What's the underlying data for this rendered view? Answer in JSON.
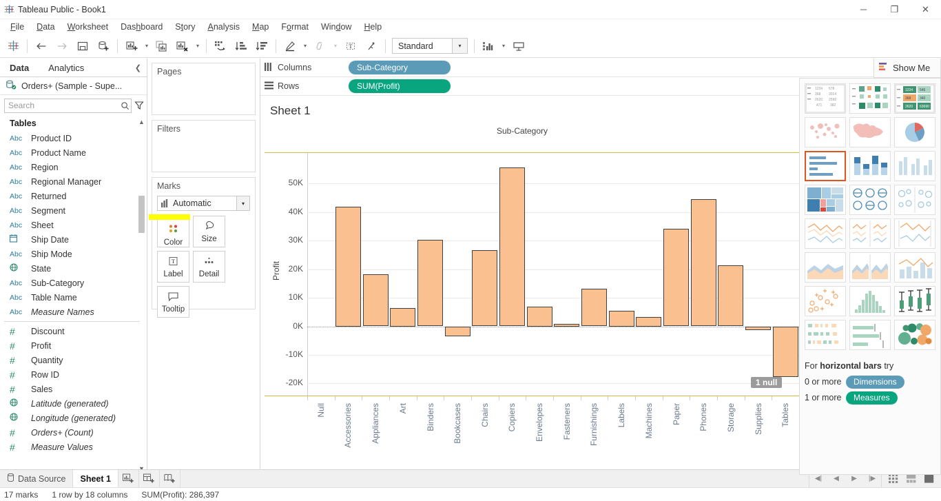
{
  "window": {
    "title": "Tableau Public - Book1",
    "logo_icon": "tableau-logo-icon",
    "minimize": "─",
    "maximize": "❐",
    "close": "✕"
  },
  "menubar": {
    "items": [
      "File",
      "Data",
      "Worksheet",
      "Dashboard",
      "Story",
      "Analysis",
      "Map",
      "Format",
      "Window",
      "Help"
    ]
  },
  "toolbar": {
    "fit_value": "Standard",
    "icons": [
      "tableau-home-icon",
      "undo-icon",
      "redo-icon",
      "save-icon",
      "new-data-source-icon",
      "new-worksheet-icon",
      "duplicate-sheet-icon",
      "clear-sheet-icon",
      "swap-rows-columns-icon",
      "sort-ascending-icon",
      "sort-descending-icon",
      "highlight-icon",
      "group-members-icon",
      "show-mark-labels-icon",
      "presentation-fix-icon",
      "fit-dropdown-icon",
      "show-hide-cards-icon",
      "presentation-mode-icon"
    ]
  },
  "data_pane": {
    "tabs": [
      {
        "label": "Data",
        "active": true
      },
      {
        "label": "Analytics",
        "active": false
      }
    ],
    "collapse_icon": "chevron-left-icon",
    "data_source": "Orders+ (Sample - Supe...",
    "search": {
      "placeholder": "Search",
      "value": ""
    },
    "section_title": "Tables",
    "fields": [
      {
        "icon": "Abc",
        "kind": "text",
        "name": "Product ID",
        "italic": false
      },
      {
        "icon": "Abc",
        "kind": "text",
        "name": "Product Name",
        "italic": false
      },
      {
        "icon": "Abc",
        "kind": "text",
        "name": "Region",
        "italic": false
      },
      {
        "icon": "Abc",
        "kind": "text",
        "name": "Regional Manager",
        "italic": false
      },
      {
        "icon": "Abc",
        "kind": "text",
        "name": "Returned",
        "italic": false
      },
      {
        "icon": "Abc",
        "kind": "text",
        "name": "Segment",
        "italic": false
      },
      {
        "icon": "Abc",
        "kind": "text",
        "name": "Sheet",
        "italic": false
      },
      {
        "icon": "📅",
        "kind": "date",
        "name": "Ship Date",
        "italic": false
      },
      {
        "icon": "Abc",
        "kind": "text",
        "name": "Ship Mode",
        "italic": false
      },
      {
        "icon": "⊕",
        "kind": "geo",
        "name": "State",
        "italic": false
      },
      {
        "icon": "Abc",
        "kind": "text",
        "name": "Sub-Category",
        "italic": false
      },
      {
        "icon": "Abc",
        "kind": "text",
        "name": "Table Name",
        "italic": false
      },
      {
        "icon": "Abc",
        "kind": "text",
        "name": "Measure Names",
        "italic": true
      },
      {
        "icon": "#",
        "kind": "number",
        "name": "Discount",
        "italic": false,
        "divider_before": true
      },
      {
        "icon": "#",
        "kind": "number",
        "name": "Profit",
        "italic": false
      },
      {
        "icon": "#",
        "kind": "number",
        "name": "Quantity",
        "italic": false
      },
      {
        "icon": "#",
        "kind": "number",
        "name": "Row ID",
        "italic": false
      },
      {
        "icon": "#",
        "kind": "number",
        "name": "Sales",
        "italic": false
      },
      {
        "icon": "⊕",
        "kind": "geo",
        "name": "Latitude (generated)",
        "italic": true
      },
      {
        "icon": "⊕",
        "kind": "geo",
        "name": "Longitude (generated)",
        "italic": true
      },
      {
        "icon": "#",
        "kind": "number",
        "name": "Orders+ (Count)",
        "italic": true
      },
      {
        "icon": "#",
        "kind": "number",
        "name": "Measure Values",
        "italic": true
      }
    ]
  },
  "cards": {
    "pages_title": "Pages",
    "filters_title": "Filters",
    "marks_title": "Marks",
    "marks_type": "Automatic",
    "marks_type_icon": "bar-mark-icon",
    "buttons": [
      {
        "label": "Color",
        "icon": "color-palette-icon",
        "highlighted": true
      },
      {
        "label": "Size",
        "icon": "size-icon",
        "highlighted": false
      },
      {
        "label": "Label",
        "icon": "label-text-icon",
        "highlighted": false
      },
      {
        "label": "Detail",
        "icon": "detail-dots-icon",
        "highlighted": false
      },
      {
        "label": "Tooltip",
        "icon": "tooltip-bubble-icon",
        "highlighted": false
      }
    ]
  },
  "shelves": {
    "columns_label": "Columns",
    "columns_icon": "columns-icon",
    "columns_pill": "Sub-Category",
    "rows_label": "Rows",
    "rows_icon": "rows-icon",
    "rows_pill": "SUM(Profit)"
  },
  "sheet": {
    "title": "Sheet 1",
    "null_indicator": "1 null"
  },
  "chart_data": {
    "type": "bar",
    "title": "Sheet 1",
    "xlabel": "Sub-Category",
    "ylabel": "Profit",
    "ylim": [
      -24000,
      60000
    ],
    "yticks": [
      50000,
      40000,
      30000,
      20000,
      10000,
      0,
      -10000,
      -20000
    ],
    "ytick_labels": [
      "50K",
      "40K",
      "30K",
      "20K",
      "10K",
      "0K",
      "-10K",
      "-20K"
    ],
    "grid": true,
    "legend": "none",
    "bar_color": "#fac08f",
    "bar_border_color": "#404040",
    "categories": [
      "Null",
      "Accessories",
      "Appliances",
      "Art",
      "Binders",
      "Bookcases",
      "Chairs",
      "Copiers",
      "Envelopes",
      "Fasteners",
      "Furnishings",
      "Labels",
      "Machines",
      "Paper",
      "Phones",
      "Storage",
      "Supplies",
      "Tables"
    ],
    "values": [
      null,
      41937,
      18138,
      6528,
      30222,
      -3473,
      26590,
      55618,
      6964,
      950,
      13059,
      5546,
      3385,
      34054,
      44516,
      21279,
      -1189,
      -17725
    ]
  },
  "show_me": {
    "tab_label": "Show Me",
    "tab_icon": "show-me-icon",
    "hint_prefix": "For",
    "hint_bold": "horizontal bars",
    "hint_suffix": "try",
    "req_dimensions_prefix": "0 or more",
    "req_dimensions_pill": "Dimensions",
    "req_measures_prefix": "1 or more",
    "req_measures_pill": "Measures",
    "thumbnails": [
      {
        "name": "text-table",
        "selected": false
      },
      {
        "name": "heat-map",
        "selected": false
      },
      {
        "name": "highlight-table",
        "selected": false
      },
      {
        "name": "symbol-map",
        "selected": false
      },
      {
        "name": "filled-map",
        "selected": false
      },
      {
        "name": "pie-chart",
        "selected": false
      },
      {
        "name": "horizontal-bars",
        "selected": true
      },
      {
        "name": "stacked-bars",
        "selected": false
      },
      {
        "name": "side-by-side-bars",
        "selected": false
      },
      {
        "name": "treemap",
        "selected": false
      },
      {
        "name": "circle-views",
        "selected": false
      },
      {
        "name": "side-by-side-circles",
        "selected": false
      },
      {
        "name": "lines-continuous",
        "selected": false
      },
      {
        "name": "lines-discrete",
        "selected": false
      },
      {
        "name": "dual-lines",
        "selected": false
      },
      {
        "name": "area-charts-continuous",
        "selected": false
      },
      {
        "name": "area-charts-discrete",
        "selected": false
      },
      {
        "name": "dual-combination",
        "selected": false
      },
      {
        "name": "scatter-plot",
        "selected": false
      },
      {
        "name": "histogram",
        "selected": false
      },
      {
        "name": "box-and-whisker",
        "selected": false
      },
      {
        "name": "gantt",
        "selected": false
      },
      {
        "name": "bullet-graph",
        "selected": false
      },
      {
        "name": "packed-bubbles",
        "selected": false
      }
    ]
  },
  "bottom": {
    "data_source_tab": "Data Source",
    "sheet_tab": "Sheet 1",
    "new_worksheet_icon": "new-worksheet-icon",
    "new_dashboard_icon": "new-dashboard-icon",
    "new_story_icon": "new-story-icon",
    "nav_first": "◀|",
    "nav_prev": "◀",
    "nav_next": "▶",
    "nav_last": "|▶",
    "view_sheetsort": "sheet-sorter-icon",
    "view_filmstrip": "filmstrip-icon",
    "view_single": "single-view-icon"
  },
  "status": {
    "marks": "17 marks",
    "dimensions": "1 row by 18 columns",
    "aggregate": "SUM(Profit): 286,397"
  }
}
